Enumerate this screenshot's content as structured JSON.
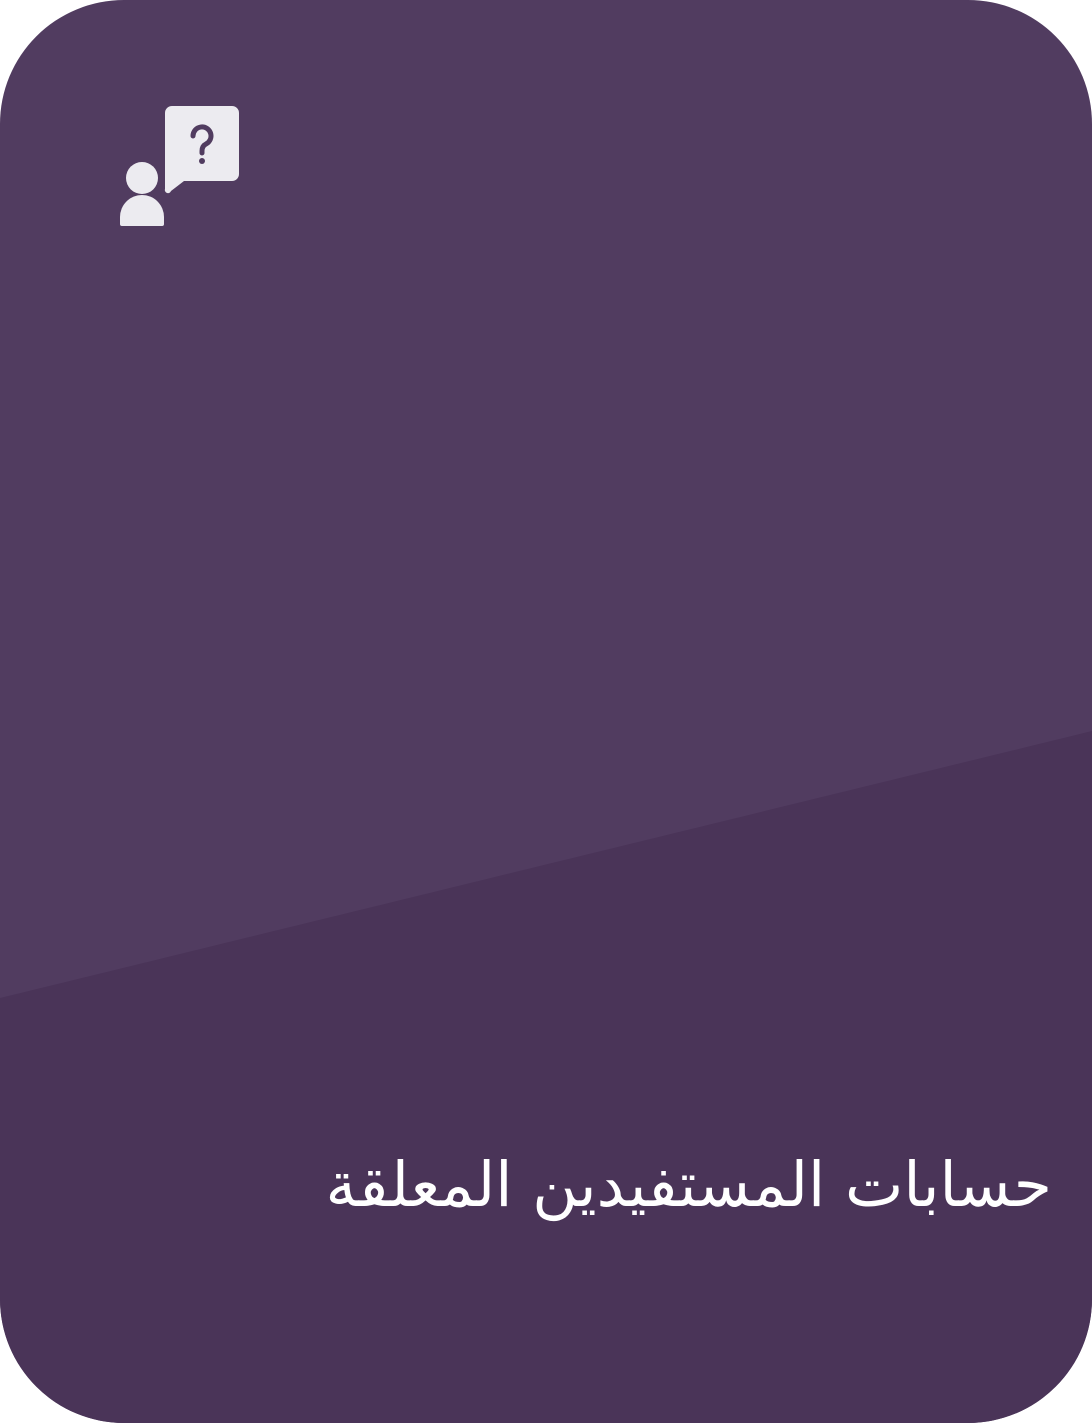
{
  "card": {
    "title": "حسابات المستفيدين المعلقة",
    "icon": "user-question-icon",
    "colors": {
      "background": "#513c60",
      "lower_shade": "#4a3458",
      "icon": "#ecebf0",
      "text": "#ffffff"
    }
  }
}
